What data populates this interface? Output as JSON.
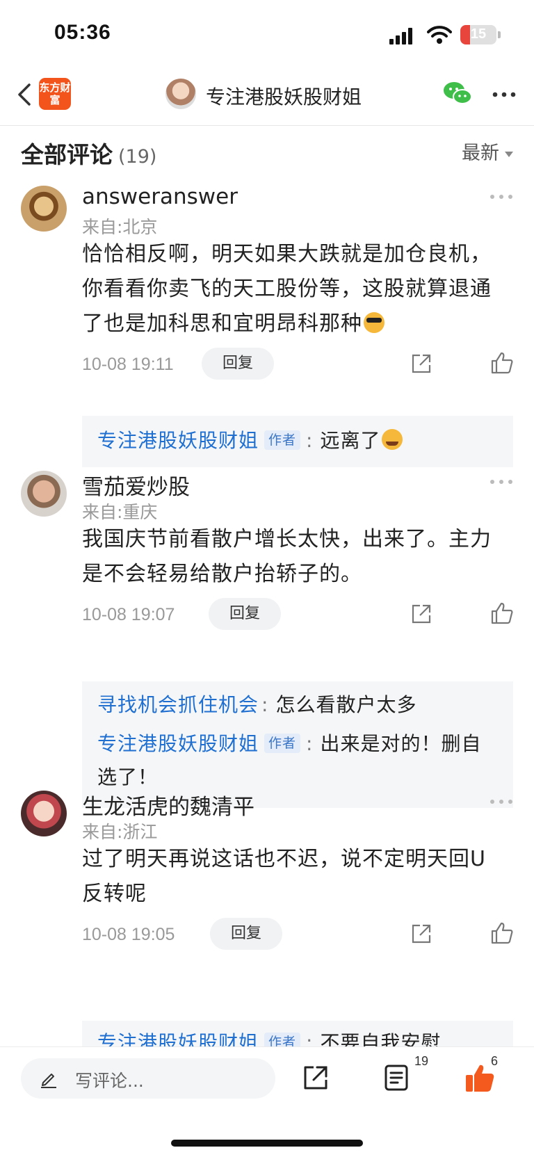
{
  "status_bar": {
    "time": "05:36",
    "battery": "15"
  },
  "nav": {
    "app_logo": "东方财富",
    "title": "专注港股妖股财姐"
  },
  "header": {
    "title": "全部评论",
    "count": "(19)",
    "sort": "最新"
  },
  "comments": [
    {
      "user": "answeranswer",
      "location": "来自:北京",
      "text": "恰恰相反啊，明天如果大跌就是加仓良机，你看看你卖飞的天工股份等，这股就算退通了也是加科思和宜明昂科那种",
      "emoji": "cool-sunglasses-emoji",
      "time": "10-08 19:11",
      "reply_label": "回复",
      "replies": [
        {
          "name": "专注港股妖股财姐",
          "badge": "作者",
          "colon": ":",
          "text": "远离了",
          "emoji": "laugh-cry-emoji"
        }
      ]
    },
    {
      "user": "雪茄爱炒股",
      "location": "来自:重庆",
      "text": "我国庆节前看散户增长太快，出来了。主力是不会轻易给散户抬轿子的。",
      "time": "10-08 19:07",
      "reply_label": "回复",
      "replies": [
        {
          "name": "寻找机会抓住机会",
          "colon": ":",
          "text": "怎么看散户太多"
        },
        {
          "name": "专注港股妖股财姐",
          "badge": "作者",
          "colon": ":",
          "text": "出来是对的！删自选了！"
        }
      ]
    },
    {
      "user": "生龙活虎的魏清平",
      "location": "来自:浙江",
      "text": "过了明天再说这话也不迟，说不定明天回U反转呢",
      "time": "10-08 19:05",
      "reply_label": "回复",
      "replies": [
        {
          "name": "专注港股妖股财姐",
          "badge": "作者",
          "colon": ":",
          "text": "不要自我安慰"
        }
      ]
    }
  ],
  "bottom_bar": {
    "write_placeholder": "写评论...",
    "comment_count": "19",
    "like_count": "6"
  },
  "colors": {
    "brand": "#f3541b",
    "link": "#1f6fd1",
    "like": "#f45a1e"
  }
}
